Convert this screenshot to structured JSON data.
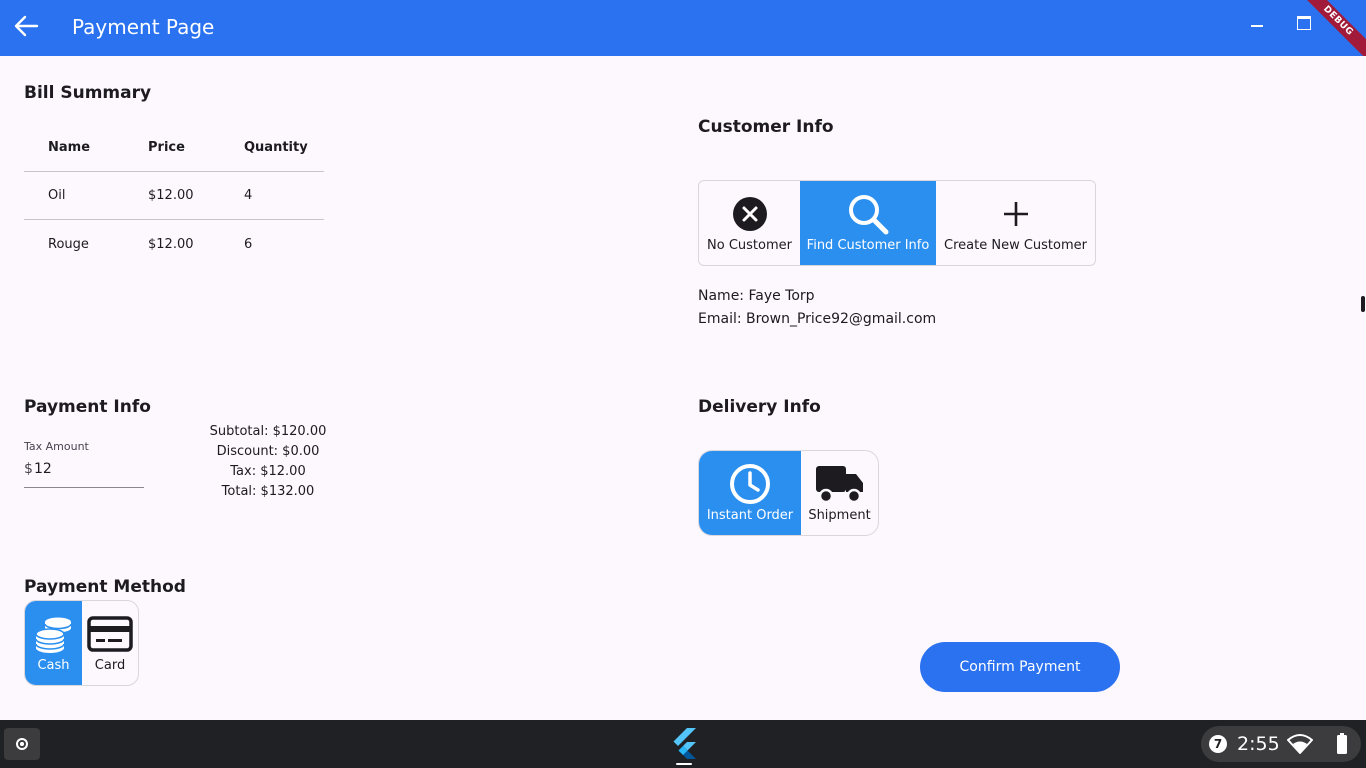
{
  "app_bar": {
    "title": "Payment Page",
    "debug_label": "DEBUG",
    "icons": {
      "back": "arrow-left-icon",
      "minimize": "minimize-icon",
      "maximize": "maximize-icon"
    }
  },
  "bill_summary": {
    "title": "Bill Summary",
    "columns": [
      "Name",
      "Price",
      "Quantity"
    ],
    "rows": [
      {
        "name": "Oil",
        "price": "$12.00",
        "quantity": "4"
      },
      {
        "name": "Rouge",
        "price": "$12.00",
        "quantity": "6"
      }
    ]
  },
  "payment_info": {
    "title": "Payment Info",
    "tax_label": "Tax Amount",
    "tax_prefix": "$",
    "tax_value": "12",
    "subtotal": "Subtotal: $120.00",
    "discount": "Discount: $0.00",
    "tax": "Tax: $12.00",
    "total": "Total: $132.00"
  },
  "payment_method": {
    "title": "Payment Method",
    "options": [
      {
        "label": "Cash",
        "icon": "coins-stack-icon",
        "selected": true
      },
      {
        "label": "Card",
        "icon": "credit-card-icon",
        "selected": false
      }
    ]
  },
  "customer_info": {
    "title": "Customer Info",
    "options": [
      {
        "label": "No Customer",
        "icon": "cancel-circle-icon",
        "selected": false
      },
      {
        "label": "Find Customer Info",
        "icon": "search-icon",
        "selected": true
      },
      {
        "label": "Create New Customer",
        "icon": "plus-icon",
        "selected": false
      }
    ],
    "name_line": "Name: Faye Torp",
    "email_line": "Email: Brown_Price92@gmail.com"
  },
  "delivery_info": {
    "title": "Delivery Info",
    "options": [
      {
        "label": "Instant Order",
        "icon": "clock-icon",
        "selected": true
      },
      {
        "label": "Shipment",
        "icon": "truck-icon",
        "selected": false
      }
    ]
  },
  "confirm_button": "Confirm Payment",
  "taskbar": {
    "notification_count": "7",
    "time": "2:55",
    "icons": {
      "launcher": "launcher-icon",
      "app": "flutter-logo-icon",
      "wifi": "wifi-icon",
      "battery": "battery-icon"
    }
  },
  "colors": {
    "primary": "#2b72f0",
    "selected_segment": "#2b8ff0",
    "background": "#fdf7fe",
    "taskbar": "#202124"
  }
}
